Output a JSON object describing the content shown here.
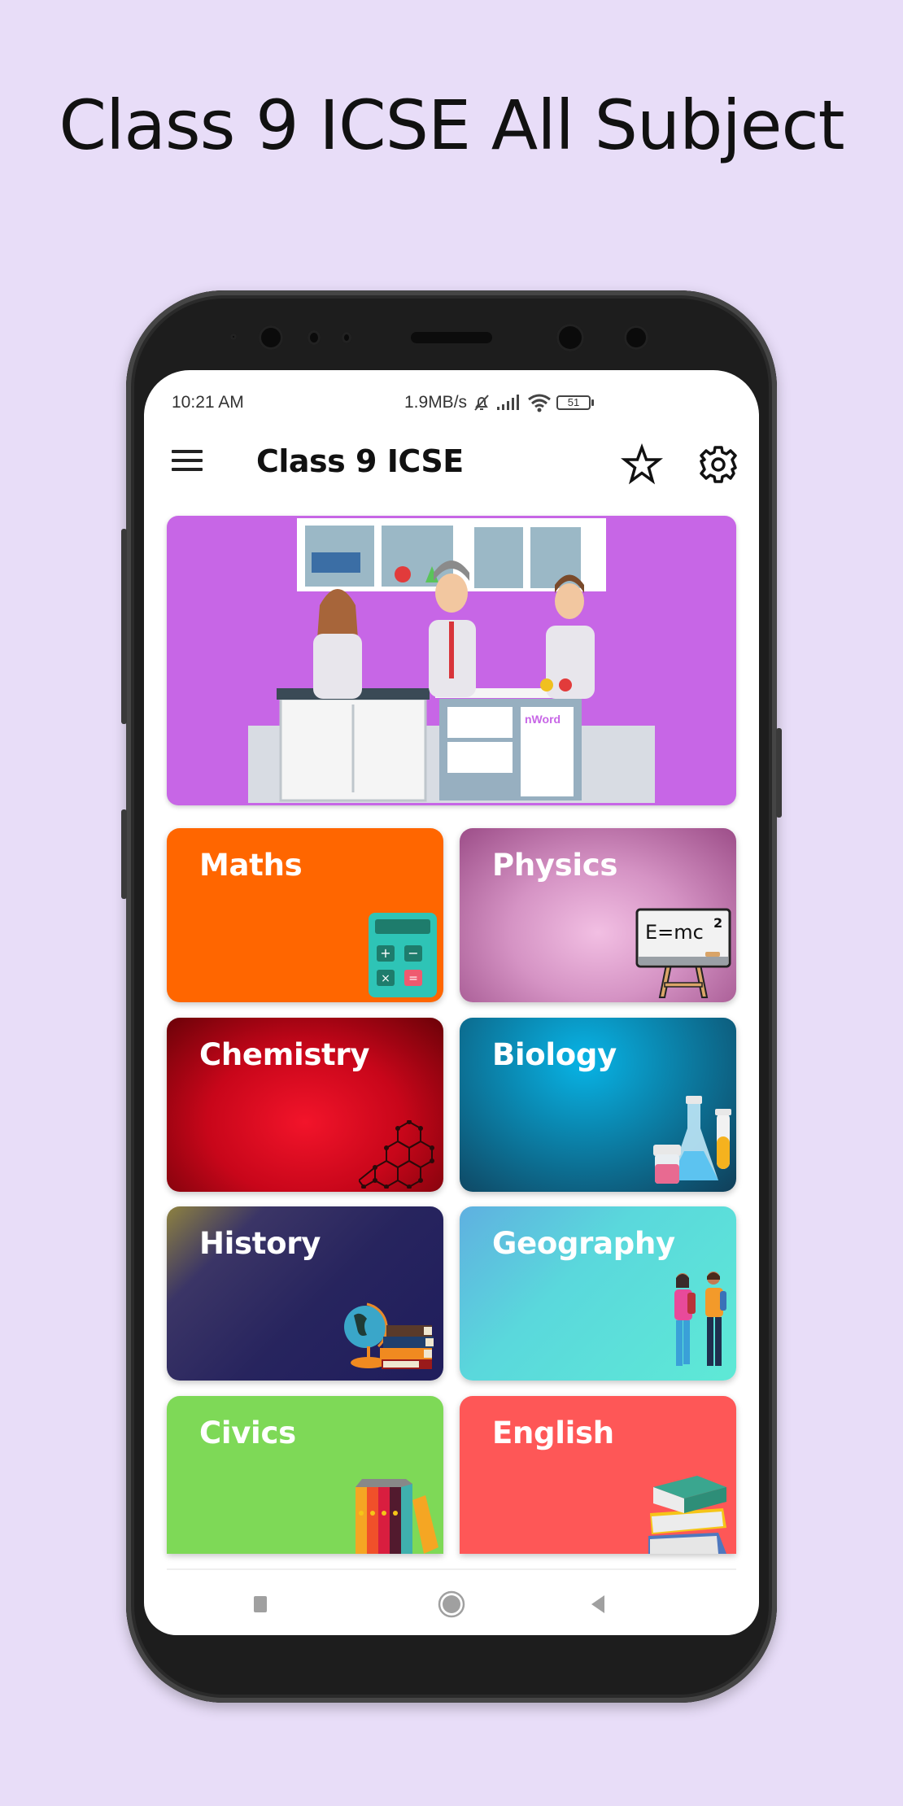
{
  "headline": "Class 9 ICSE All Subject",
  "status_bar": {
    "time": "10:21 AM",
    "network_speed": "1.9MB/s",
    "icons": [
      "bell-muted-icon",
      "signal-icon",
      "wifi-icon"
    ],
    "battery_level": "51"
  },
  "toolbar": {
    "menu_icon": "hamburger-menu-icon",
    "title": "Class 9 ICSE",
    "favorite_icon": "star-icon",
    "settings_icon": "gear-icon"
  },
  "banner": {
    "description": "Scientists in laboratory illustration",
    "watermark": "nWord",
    "color": "#c766e6"
  },
  "subjects": [
    {
      "label": "Maths",
      "icon": "calculator-icon",
      "color": "#ff6600"
    },
    {
      "label": "Physics",
      "icon": "blackboard-emc2-icon",
      "board_text": "E=mc",
      "board_sup": "2",
      "color": "#d593c4"
    },
    {
      "label": "Chemistry",
      "icon": "molecule-hexagon-icon",
      "color": "#e0081e"
    },
    {
      "label": "Biology",
      "icon": "lab-flask-icon",
      "color": "#0b7fa6"
    },
    {
      "label": "History",
      "icon": "globe-books-icon",
      "color": "#27245e"
    },
    {
      "label": "Geography",
      "icon": "students-icon",
      "color": "#5ee9d6"
    },
    {
      "label": "Civics",
      "icon": "book-row-icon",
      "color": "#7ed957"
    },
    {
      "label": "English",
      "icon": "book-stack-icon",
      "color": "#fe5757"
    }
  ],
  "nav_bar": {
    "recents": "recents-square-icon",
    "home": "home-circle-icon",
    "back": "back-triangle-icon"
  }
}
